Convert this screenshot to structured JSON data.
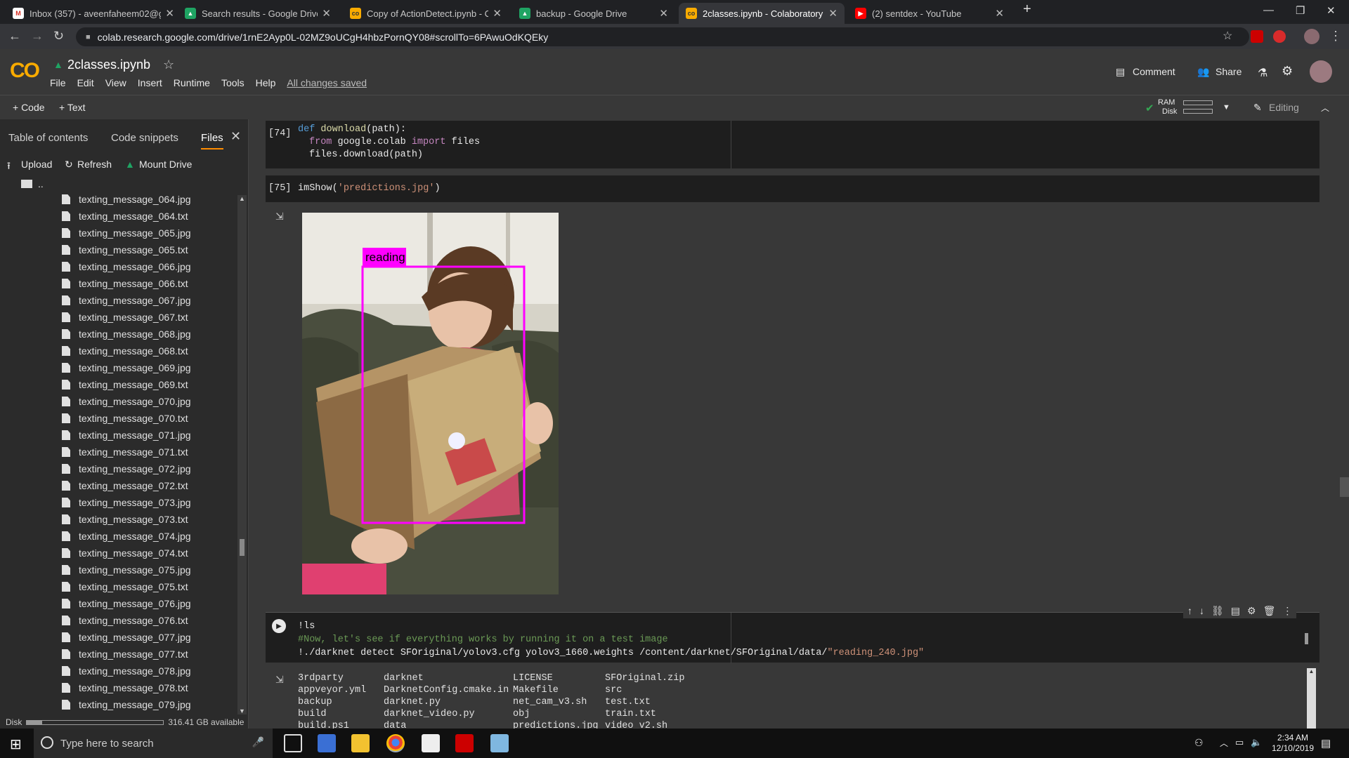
{
  "browser": {
    "tabs": [
      {
        "title": "Inbox (357) - aveenfaheem02@g",
        "icon": "gmail-icon",
        "active": false
      },
      {
        "title": "Search results - Google Drive",
        "icon": "drive-icon",
        "active": false
      },
      {
        "title": "Copy of ActionDetect.ipynb - Col",
        "icon": "colab-icon",
        "active": false
      },
      {
        "title": "backup - Google Drive",
        "icon": "drive-icon",
        "active": false
      },
      {
        "title": "2classes.ipynb - Colaboratory",
        "icon": "colab-icon",
        "active": true
      },
      {
        "title": "(2) sentdex - YouTube",
        "icon": "youtube-icon",
        "active": false
      }
    ],
    "url": "colab.research.google.com/drive/1rnE2Ayp0L-02MZ9oUCgH4hbzPornQY08#scrollTo=6PAwuOdKQEky"
  },
  "colab": {
    "logo": "CO",
    "notebook_title": "2classes.ipynb",
    "menu": [
      "File",
      "Edit",
      "View",
      "Insert",
      "Runtime",
      "Tools",
      "Help"
    ],
    "saved_status": "All changes saved",
    "comment_label": "Comment",
    "share_label": "Share",
    "add_code_label": "+ Code",
    "add_text_label": "+ Text",
    "ram_label": "RAM",
    "disk_label": "Disk",
    "editing_label": "Editing"
  },
  "sidebar": {
    "tabs": [
      "Table of contents",
      "Code snippets",
      "Files"
    ],
    "active_tab": "Files",
    "upload_label": "Upload",
    "refresh_label": "Refresh",
    "mount_label": "Mount Drive",
    "parent_dir": "..",
    "files": [
      "texting_message_064.jpg",
      "texting_message_064.txt",
      "texting_message_065.jpg",
      "texting_message_065.txt",
      "texting_message_066.jpg",
      "texting_message_066.txt",
      "texting_message_067.jpg",
      "texting_message_067.txt",
      "texting_message_068.jpg",
      "texting_message_068.txt",
      "texting_message_069.jpg",
      "texting_message_069.txt",
      "texting_message_070.jpg",
      "texting_message_070.txt",
      "texting_message_071.jpg",
      "texting_message_071.txt",
      "texting_message_072.jpg",
      "texting_message_072.txt",
      "texting_message_073.jpg",
      "texting_message_073.txt",
      "texting_message_074.jpg",
      "texting_message_074.txt",
      "texting_message_075.jpg",
      "texting_message_075.txt",
      "texting_message_076.jpg",
      "texting_message_076.txt",
      "texting_message_077.jpg",
      "texting_message_077.txt",
      "texting_message_078.jpg",
      "texting_message_078.txt",
      "texting_message_079.jpg"
    ],
    "disk_label": "Disk",
    "disk_available": "316.41 GB available"
  },
  "cells": {
    "c74": {
      "prompt": "[74]",
      "line1_kw": "def",
      "line1_fn": "download",
      "line1_rest": "(path):",
      "line2_kw": "from",
      "line2_mod": " google.colab ",
      "line2_imp": "import",
      "line2_rest": " files",
      "line3": "files.download(path)"
    },
    "c75": {
      "prompt": "[75]",
      "code_fn": "imShow(",
      "code_str": "'predictions.jpg'",
      "code_end": ")",
      "detection_label": "reading"
    },
    "c76": {
      "line1": "!ls",
      "line2": "#Now, let's see if everything works by running it on a test image",
      "line3_cmd": "!./darknet detect SFOriginal/yolov3.cfg yolov3_1660.weights /content/darknet/SFOriginal/data/",
      "line3_str": "\"reading_240.jpg\"",
      "ls_output": [
        [
          "3rdparty",
          "darknet",
          "LICENSE",
          "SFOriginal.zip"
        ],
        [
          "appveyor.yml",
          "DarknetConfig.cmake.in",
          "Makefile",
          "src"
        ],
        [
          "backup",
          "darknet.py",
          "net_cam_v3.sh",
          "test.txt"
        ],
        [
          "build",
          "darknet_video.py",
          "obj",
          "train.txt"
        ],
        [
          "build.ps1",
          "data",
          "predictions.jpg",
          "video_v2.sh"
        ]
      ]
    }
  },
  "taskbar": {
    "search_placeholder": "Type here to search",
    "time": "2:34 AM",
    "date": "12/10/2019"
  }
}
